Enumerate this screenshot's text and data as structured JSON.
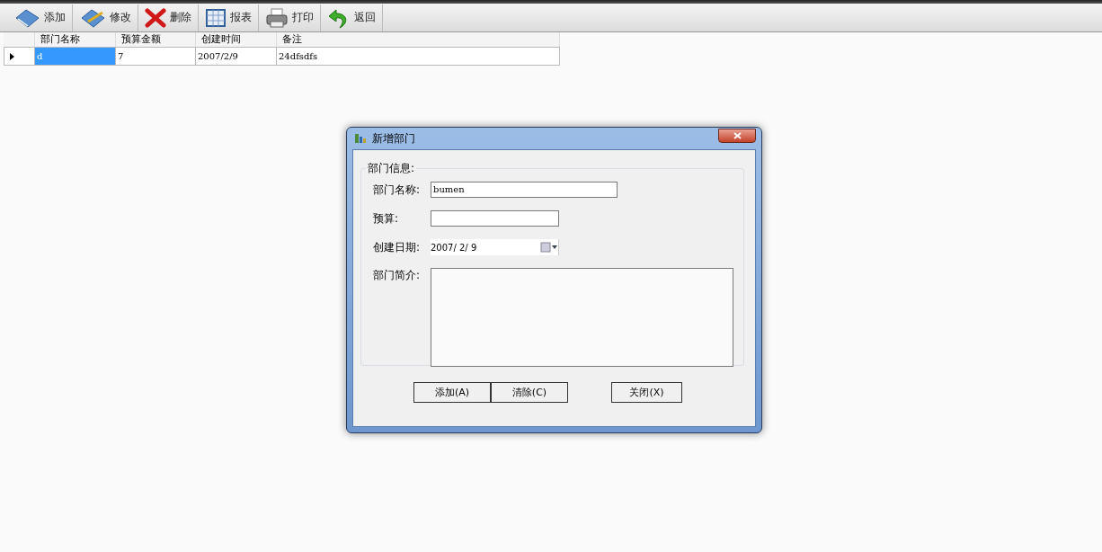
{
  "toolbar": {
    "buttons": [
      {
        "kind": "add",
        "label": "添加"
      },
      {
        "kind": "edit",
        "label": "修改"
      },
      {
        "kind": "delete",
        "label": "删除"
      },
      {
        "kind": "report",
        "label": "报表"
      },
      {
        "kind": "print",
        "label": "打印"
      },
      {
        "kind": "back",
        "label": "返回"
      }
    ]
  },
  "table": {
    "columns": [
      "部门名称",
      "预算金额",
      "创建时间",
      "备注"
    ],
    "rows": [
      {
        "selected": true,
        "cells": [
          "d",
          "7",
          "2007/2/9",
          "24dfsdfs"
        ]
      }
    ]
  },
  "dialog": {
    "title": "新增部门",
    "group_title": "部门信息:",
    "fields": [
      {
        "kind": "text",
        "label": "部门名称:",
        "value": "bumen"
      },
      {
        "kind": "text",
        "label": "预算:"
      },
      {
        "kind": "date",
        "label": "创建日期:",
        "value": "2007/ 2/ 9"
      },
      {
        "kind": "memo",
        "label": "部门简介:"
      }
    ],
    "buttons": [
      "添加(A)",
      "清除(C)",
      "关闭(X)"
    ]
  }
}
